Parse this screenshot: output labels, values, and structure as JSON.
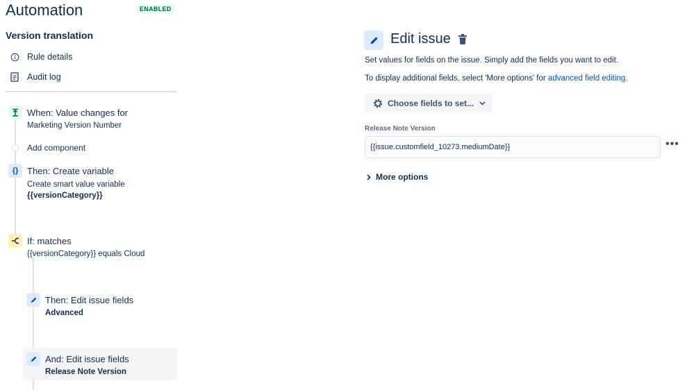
{
  "header": {
    "title": "Automation",
    "status_badge": "ENABLED"
  },
  "rule": {
    "name": "Version translation"
  },
  "sidebar": {
    "links": [
      {
        "label": "Rule details",
        "icon": "info-icon"
      },
      {
        "label": "Audit log",
        "icon": "document-icon"
      }
    ]
  },
  "flow": {
    "trigger": {
      "title": "When: Value changes for",
      "subtitle": "Marketing Version Number",
      "icon": "trigger-icon"
    },
    "add_component": "Add component",
    "create_variable": {
      "title": "Then: Create variable",
      "subtitle": "Create smart value variable",
      "detail": "{{versionCategory}}",
      "icon_text": "{}"
    },
    "condition": {
      "title": "If: matches",
      "subtitle": "{{versionCategory}} equals Cloud"
    },
    "action1": {
      "title": "Then: Edit issue fields",
      "detail": "Advanced"
    },
    "action2": {
      "title": "And: Edit issue fields",
      "detail": "Release Note Version"
    }
  },
  "panel": {
    "title": "Edit issue",
    "desc1": "Set values for fields on the issue. Simply add the fields you want to edit.",
    "desc2_prefix": "To display additional fields, select 'More options' for ",
    "desc2_link": "advanced field editing",
    "desc2_suffix": ".",
    "choose_fields": "Choose fields to set...",
    "field_label": "Release Note Version",
    "field_value": "{{issue.customfield_10273.mediumDate}}",
    "more_menu": "•••",
    "more_options": "More options"
  },
  "colors": {
    "accent": "#0052cc",
    "trigger_bg": "#e3fcef",
    "trigger_fg": "#006644",
    "action_bg": "#deebff",
    "condition_bg": "#fff0b3",
    "condition_fg": "#172b4d"
  }
}
